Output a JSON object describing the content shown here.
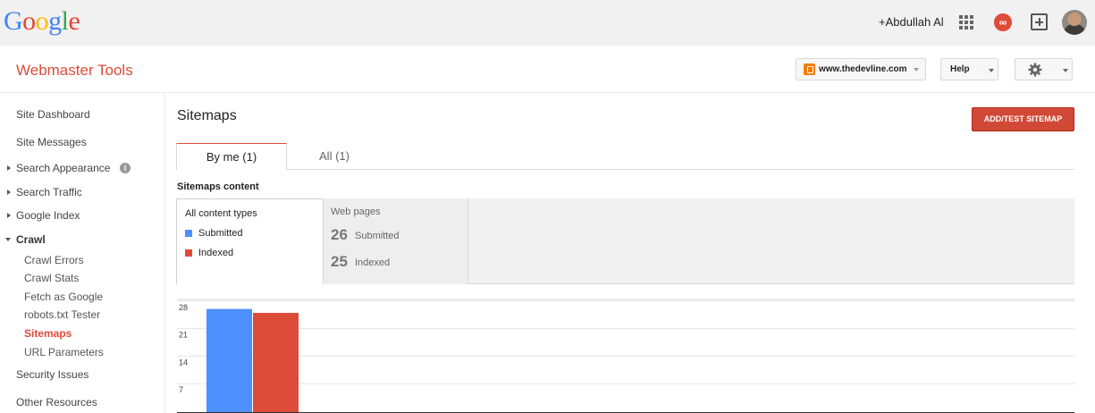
{
  "topbar": {
    "logo_letters": [
      {
        "char": "G",
        "color": "#4285f4"
      },
      {
        "char": "o",
        "color": "#ea4335"
      },
      {
        "char": "o",
        "color": "#fbbc05"
      },
      {
        "char": "g",
        "color": "#4285f4"
      },
      {
        "char": "l",
        "color": "#34a853"
      },
      {
        "char": "e",
        "color": "#ea4335"
      }
    ],
    "user_name": "+Abdullah Al",
    "notification_glyph": "∞"
  },
  "header": {
    "product_name": "Webmaster Tools",
    "site_selector": "www.thedevline.com",
    "help_label": "Help"
  },
  "sidebar": {
    "site_dashboard": "Site Dashboard",
    "site_messages": "Site Messages",
    "search_appearance": "Search Appearance",
    "search_traffic": "Search Traffic",
    "google_index": "Google Index",
    "crawl": "Crawl",
    "crawl_items": [
      "Crawl Errors",
      "Crawl Stats",
      "Fetch as Google",
      "robots.txt Tester",
      "Sitemaps",
      "URL Parameters"
    ],
    "active_item": "Sitemaps",
    "security_issues": "Security Issues",
    "other_resources": "Other Resources"
  },
  "main": {
    "title": "Sitemaps",
    "add_button": "ADD/TEST SITEMAP",
    "tabs": [
      {
        "label": "By me (1)",
        "selected": true
      },
      {
        "label": "All (1)",
        "selected": false
      }
    ],
    "section_title": "Sitemaps content",
    "content_types_label": "All content types",
    "legend": [
      {
        "label": "Submitted",
        "color": "#4d90fe"
      },
      {
        "label": "Indexed",
        "color": "#dd4b39"
      }
    ],
    "web_pages": {
      "heading": "Web pages",
      "submitted_value": "26",
      "submitted_label": "Submitted",
      "indexed_value": "25",
      "indexed_label": "Indexed"
    }
  },
  "chart_data": {
    "type": "bar",
    "categories": [
      "Web pages"
    ],
    "series": [
      {
        "name": "Submitted",
        "values": [
          26
        ],
        "color": "#4d90fe"
      },
      {
        "name": "Indexed",
        "values": [
          25
        ],
        "color": "#dd4b39"
      }
    ],
    "yticks": [
      7,
      14,
      21,
      28
    ],
    "ylim": [
      0,
      30
    ],
    "grid": true
  }
}
